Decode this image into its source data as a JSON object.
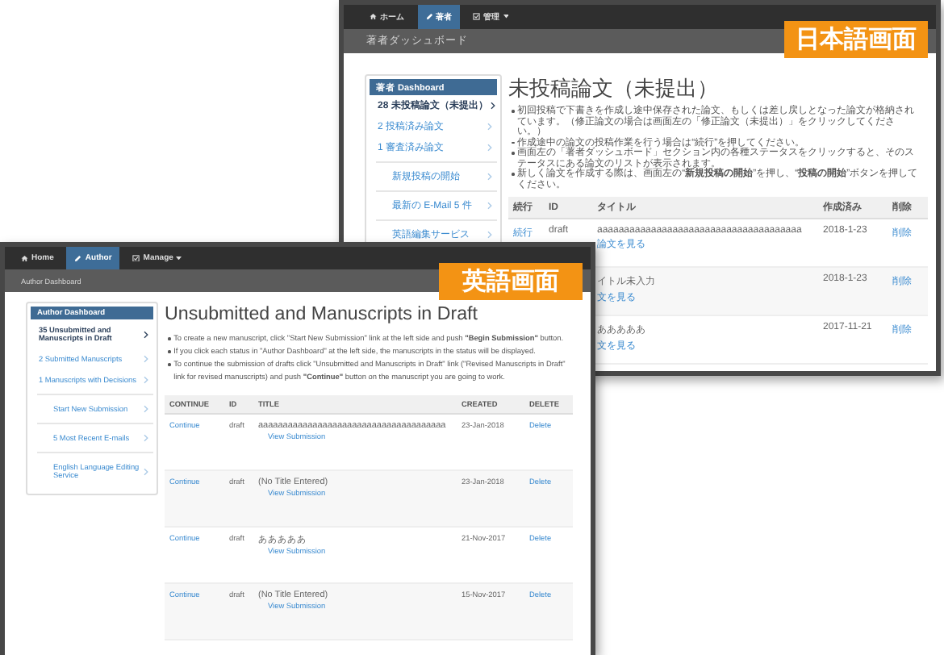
{
  "screens": [
    {
      "label": "日本語画面",
      "nav": [
        {
          "label": "ホーム",
          "dropdown": false,
          "selected": false
        },
        {
          "label": "著者",
          "dropdown": false,
          "selected": true
        },
        {
          "label": "管理",
          "dropdown": true,
          "selected": false
        }
      ],
      "breadcrumb": "著者ダッシュボード",
      "sidebar": {
        "title": "著者 Dashboard",
        "items": [
          {
            "kind": "status",
            "count": "28",
            "label": "未投稿論文（未提出）",
            "selected": true
          },
          {
            "kind": "status",
            "count": "2",
            "label": "投稿済み論文",
            "selected": false
          },
          {
            "kind": "status",
            "count": "1",
            "label": "審査済み論文",
            "selected": false
          },
          {
            "kind": "link",
            "label": "新規投稿の開始",
            "selected": false
          },
          {
            "kind": "link",
            "label": "最新の E-Mail 5 件",
            "selected": false
          },
          {
            "kind": "link",
            "label": "英語編集サービス",
            "selected": false
          }
        ]
      },
      "title": "未投稿論文（未提出）",
      "notes": [
        "初回投稿で下書きを作成し途中保存された論文、もしくは差し戻しとなった論文が格納されています。（修正論文の場合は画面左の「修正論文（未提出）」をクリックしてください。）",
        "作成途中の論文の投稿作業を行う場合は“続行”を押してください。",
        "画面左の「著者ダッシュボード」セクション内の各種ステータスをクリックすると、そのステータスにある論文のリストが表示されます。",
        "新しく論文を作成する際は、画面左の“**新規投稿の開始**”を押し、“**投稿の開始**”ボタンを押してください。"
      ],
      "columns": [
        "続行",
        "ID",
        "タイトル",
        "作成済み",
        "削除"
      ],
      "rows": [
        {
          "continue": "続行",
          "id": "draft",
          "title": "aaaaaaaaaaaaaaaaaaaaaaaaaaaaaaaaaaaaaa",
          "view": "論文を見る",
          "created": "2018-1-23",
          "delete": "削除"
        },
        {
          "title": "イトル未入力",
          "view": "文を見る",
          "created": "2018-1-23",
          "delete": "削除"
        },
        {
          "title": "あああああ",
          "view": "文を見る",
          "created": "2017-11-21",
          "delete": "削除"
        }
      ]
    },
    {
      "label": "英語画面",
      "nav": [
        {
          "label": "Home",
          "dropdown": false,
          "selected": false
        },
        {
          "label": "Author",
          "dropdown": false,
          "selected": true
        },
        {
          "label": "Manage",
          "dropdown": true,
          "selected": false
        }
      ],
      "breadcrumb": "Author Dashboard",
      "sidebar": {
        "title": "Author Dashboard",
        "items": [
          {
            "kind": "status",
            "count": "35",
            "label": "Unsubmitted and Manuscripts in Draft",
            "selected": true
          },
          {
            "kind": "status",
            "count": "2",
            "label": "Submitted Manuscripts",
            "selected": false
          },
          {
            "kind": "status",
            "count": "1",
            "label": "Manuscripts with Decisions",
            "selected": false
          },
          {
            "kind": "link",
            "label": "Start New Submission",
            "selected": false
          },
          {
            "kind": "link",
            "label": "5 Most Recent E-mails",
            "selected": false
          },
          {
            "kind": "link",
            "label": "English Language Editing Service",
            "selected": false
          }
        ]
      },
      "title": "Unsubmitted and Manuscripts in Draft",
      "notes": [
        "To create a new manuscript, click \"Start New Submission\" link at the left side and push **\"Begin Submission\"** button.",
        "If you click each status in \"Author Dashboard\" at the left side, the manuscripts in the status will be displayed.",
        "To continue the submission of drafts click \"Unsubmitted and Manuscripts in Draft\" link (\"Revised Manuscripts in Draft\" link for revised manuscripts) and push **\"Continue\"** button on the manuscript you are going to work."
      ],
      "columns": [
        "CONTINUE",
        "ID",
        "TITLE",
        "CREATED",
        "DELETE"
      ],
      "rows": [
        {
          "continue": "Continue",
          "id": "draft",
          "title": "aaaaaaaaaaaaaaaaaaaaaaaaaaaaaaaaaaaaaa",
          "view": "View Submission",
          "created": "23-Jan-2018",
          "delete": "Delete"
        },
        {
          "continue": "Continue",
          "id": "draft",
          "title": "(No Title Entered)",
          "view": "View Submission",
          "created": "23-Jan-2018",
          "delete": "Delete"
        },
        {
          "continue": "Continue",
          "id": "draft",
          "title": "あああああ",
          "view": "View Submission",
          "created": "21-Nov-2017",
          "delete": "Delete"
        },
        {
          "continue": "Continue",
          "id": "draft",
          "title": "(No Title Entered)",
          "view": "View Submission",
          "created": "15-Nov-2017",
          "delete": "Delete"
        }
      ]
    }
  ]
}
